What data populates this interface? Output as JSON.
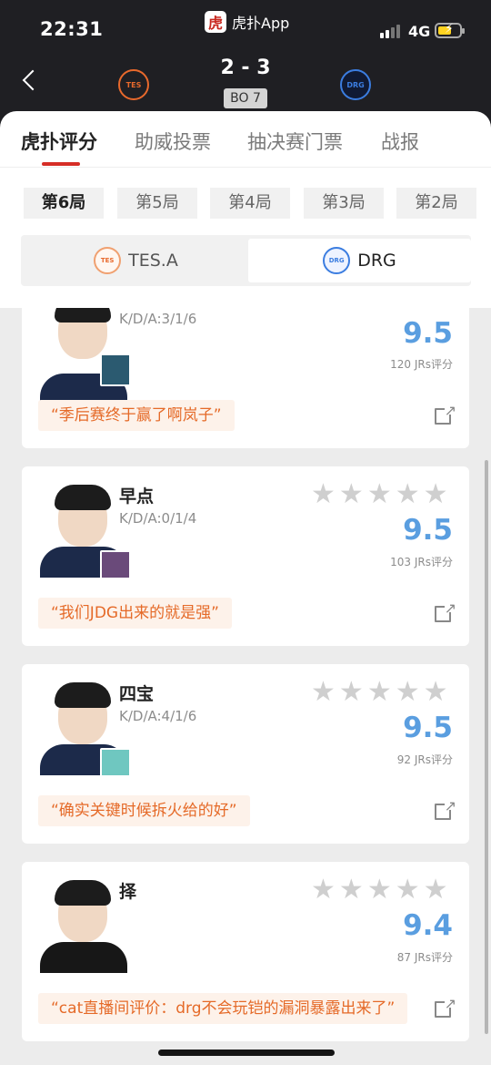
{
  "status": {
    "time": "22:31",
    "app_name": "虎扑App",
    "app_logo": "虎",
    "network": "4G",
    "bolt": "⚡"
  },
  "match": {
    "score": "2 - 3",
    "format": "BO 7",
    "team_left_logo": "TES",
    "team_right_logo": "DRG"
  },
  "tabs": [
    {
      "label": "虎扑评分",
      "active": true
    },
    {
      "label": "助威投票",
      "active": false
    },
    {
      "label": "抽决赛门票",
      "active": false
    },
    {
      "label": "战报",
      "active": false
    }
  ],
  "games": [
    {
      "label": "第6局",
      "active": true
    },
    {
      "label": "第5局",
      "active": false
    },
    {
      "label": "第4局",
      "active": false
    },
    {
      "label": "第3局",
      "active": false
    },
    {
      "label": "第2局",
      "active": false
    }
  ],
  "team_switch": {
    "left": {
      "label": "TES.A",
      "logo": "TES",
      "active": false
    },
    "right": {
      "label": "DRG",
      "logo": "DRG",
      "active": true
    }
  },
  "players": [
    {
      "name": "",
      "kda": "K/D/A:3/1/6",
      "score": "9.5",
      "votes": "120 JRs评分",
      "quote": "“季后赛终于赢了啊岚子”",
      "hero_color": "#2b5a70"
    },
    {
      "name": "早点",
      "kda": "K/D/A:0/1/4",
      "score": "9.5",
      "votes": "103 JRs评分",
      "quote": "“我们JDG出来的就是强”",
      "hero_color": "#6a4a7a"
    },
    {
      "name": "四宝",
      "kda": "K/D/A:4/1/6",
      "score": "9.5",
      "votes": "92 JRs评分",
      "quote": "“确实关键时候拆火给的好”",
      "hero_color": "#6fc7c0"
    },
    {
      "name": "择",
      "kda": "",
      "score": "9.4",
      "votes": "87 JRs评分",
      "quote": "“cat直播间评价：drg不会玩铠的漏洞暴露出来了”",
      "hero_color": ""
    }
  ],
  "star_glyph": "★"
}
